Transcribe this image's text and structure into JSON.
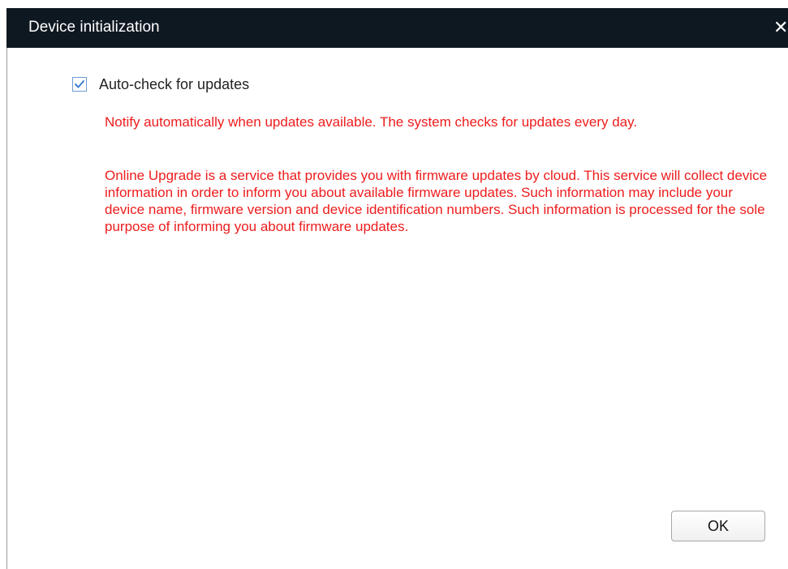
{
  "dialog": {
    "title": "Device initialization",
    "close_icon": "close-icon",
    "close_glyph": "✕"
  },
  "auto_check": {
    "label": "Auto-check for updates",
    "checked": true,
    "check_icon": "checkmark-icon"
  },
  "notices": {
    "notify_text": "Notify automatically when updates available. The system checks for updates every day.",
    "online_upgrade_text": "Online Upgrade is a service that provides you with firmware updates by cloud. This service will collect device information in order to inform you about available firmware updates. Such information may include your device name, firmware version and device identification numbers. Such information is processed for the sole purpose of informing you about firmware updates."
  },
  "actions": {
    "ok_label": "OK"
  },
  "colors": {
    "titlebar": "#0e1821",
    "notice_text": "#ee1c1c",
    "checkbox_accent": "#3b7fd0"
  }
}
